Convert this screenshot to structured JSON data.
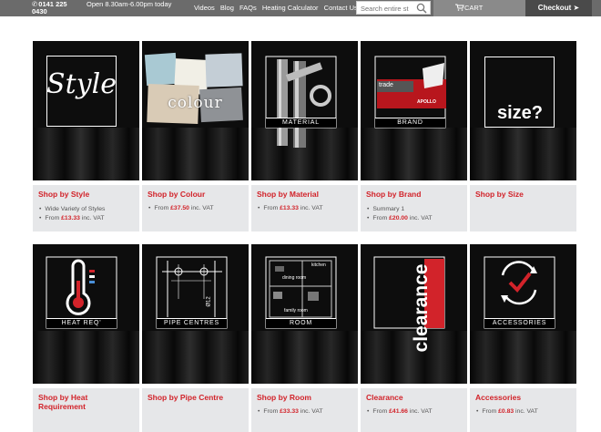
{
  "header": {
    "phone": "0141 225 0430",
    "hours": "Open 8.30am-6.00pm today",
    "nav": [
      "Videos",
      "Blog",
      "FAQs",
      "Heating Calculator",
      "Contact Us"
    ],
    "search_placeholder": "Search entire st",
    "cart_label": "CART",
    "checkout_label": "Checkout"
  },
  "tiles": [
    {
      "name": "Shop by Style",
      "image_text": "Style",
      "details": [
        {
          "text": "Wide Variety of Styles"
        },
        {
          "prefix": "From",
          "price": "£13.33",
          "suffix": "inc. VAT"
        }
      ]
    },
    {
      "name": "Shop by Colour",
      "image_text": "colour",
      "details": [
        {
          "prefix": "From",
          "price": "£37.50",
          "suffix": "inc. VAT"
        }
      ]
    },
    {
      "name": "Shop by Material",
      "image_text": "MATERIAL",
      "details": [
        {
          "prefix": "From",
          "price": "£13.33",
          "suffix": "inc. VAT"
        }
      ]
    },
    {
      "name": "Shop by Brand",
      "image_text": "BRAND",
      "details": [
        {
          "text": "Summary 1"
        },
        {
          "prefix": "From",
          "price": "£20.00",
          "suffix": "inc. VAT"
        }
      ]
    },
    {
      "name": "Shop by Size",
      "image_text": "size?",
      "details": []
    },
    {
      "name": "Shop by Heat Requirement",
      "image_text": "HEAT REQ'",
      "details": []
    },
    {
      "name": "Shop by Pipe Centre",
      "image_text": "PIPE CENTRES",
      "details": []
    },
    {
      "name": "Shop by Room",
      "image_text": "ROOM",
      "details": [
        {
          "prefix": "From",
          "price": "£33.33",
          "suffix": "inc. VAT"
        }
      ]
    },
    {
      "name": "Clearance",
      "image_text": "clearance",
      "details": [
        {
          "prefix": "From",
          "price": "£41.66",
          "suffix": "inc. VAT"
        }
      ]
    },
    {
      "name": "Accessories",
      "image_text": "ACCESSORIES",
      "details": [
        {
          "prefix": "From",
          "price": "£0.83",
          "suffix": "inc. VAT"
        }
      ]
    }
  ],
  "image_extras": {
    "brand_trade": "trade",
    "brand_apollo": "APOLLO",
    "room_kitchen": "kitchen",
    "room_dining": "dining room",
    "room_family": "family room",
    "pipe_dim": "Ø12"
  },
  "colors": {
    "accent": "#d2232a",
    "topbar": "#6b6b6b",
    "checkout": "#4a4a4a",
    "info_bg": "#e6e7e9"
  }
}
